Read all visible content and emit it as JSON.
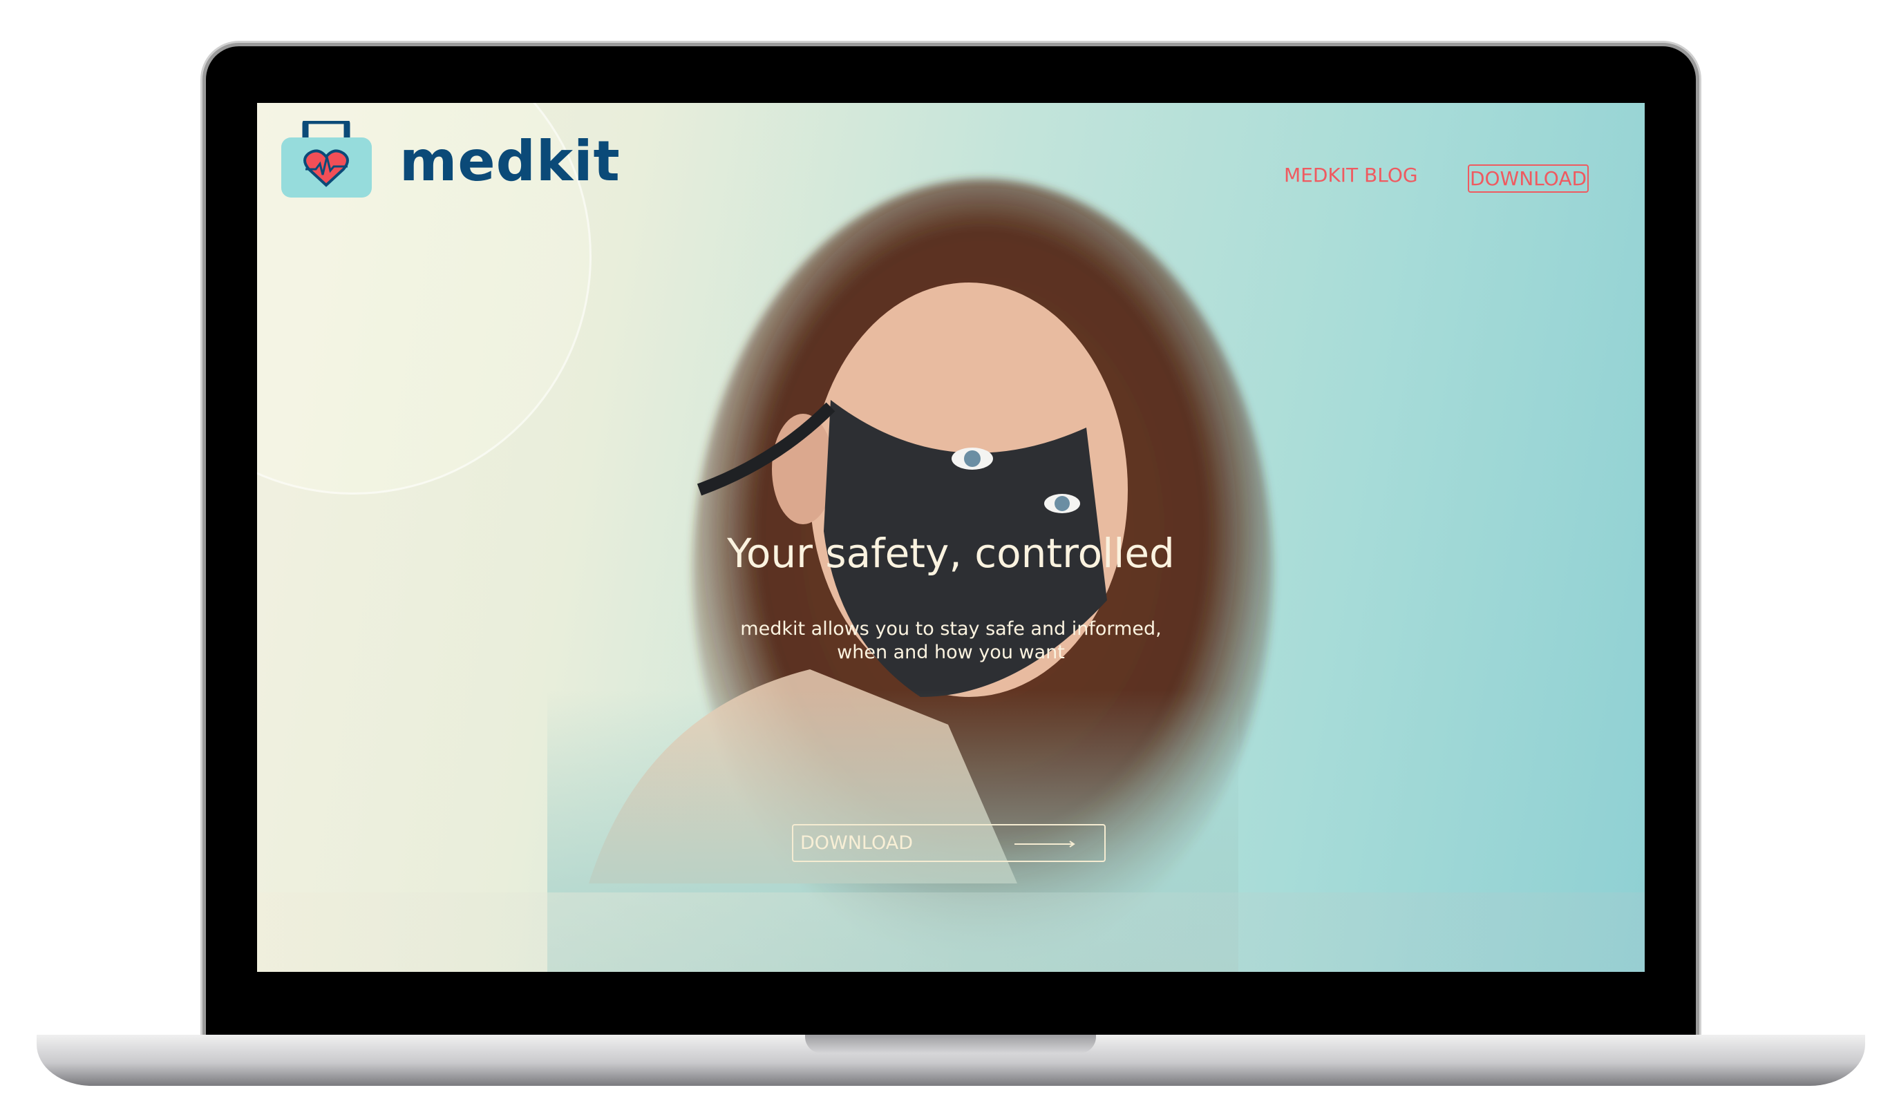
{
  "brand": {
    "name": "medkit",
    "logo_icon": "medkit-bag-heart-icon"
  },
  "nav": {
    "blog_label": "MEDKIT BLOG",
    "download_label": "DOWNLOAD"
  },
  "hero": {
    "headline": "Your safety, controlled",
    "subtitle_line1": "medkit allows you to stay safe and informed,",
    "subtitle_line2": "when and how you want",
    "cta_label": "DOWNLOAD",
    "cta_icon": "arrow-right-icon"
  },
  "colors": {
    "brand_navy": "#0b4a78",
    "accent_coral": "#ef5a60",
    "teal": "#96dcdc"
  }
}
